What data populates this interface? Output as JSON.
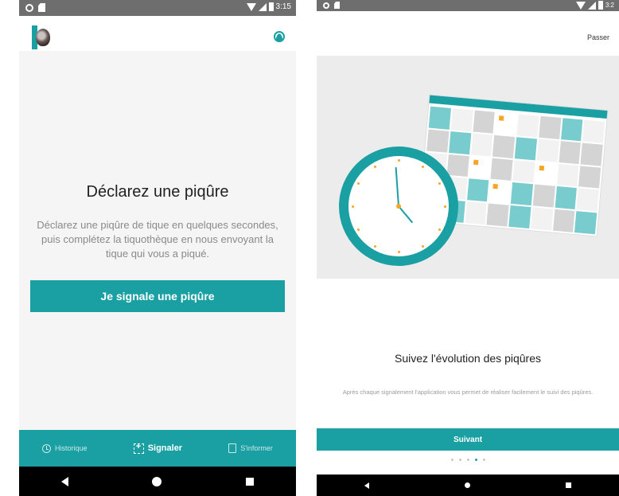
{
  "left_screen": {
    "status_bar": {
      "time": "3:15"
    },
    "main": {
      "title": "Déclarez une piqûre",
      "description": "Déclarez une piqûre de tique en quelques secondes, puis complétez la tiquothèque en nous envoyant la tique qui vous a piqué.",
      "cta_label": "Je signale une piqûre"
    },
    "bottom_nav": {
      "items": [
        {
          "label": "Historique",
          "icon": "history-icon",
          "active": false
        },
        {
          "label": "Signaler",
          "icon": "scan-add-icon",
          "active": true
        },
        {
          "label": "S'informer",
          "icon": "book-icon",
          "active": false
        }
      ]
    }
  },
  "right_screen": {
    "status_bar": {
      "time": "3:2"
    },
    "skip_label": "Passer",
    "title": "Suivez l'évolution des piqûres",
    "description": "Après chaque signalement l'application vous permet de réaliser facilement le suivi des piqûres.",
    "next_label": "Suivant",
    "pagination": {
      "total": 5,
      "current": 4
    }
  },
  "colors": {
    "accent": "#1aa0a3",
    "highlight": "#f5a623",
    "system_nav": "#000000",
    "status_bar": "#6e6e6e"
  }
}
